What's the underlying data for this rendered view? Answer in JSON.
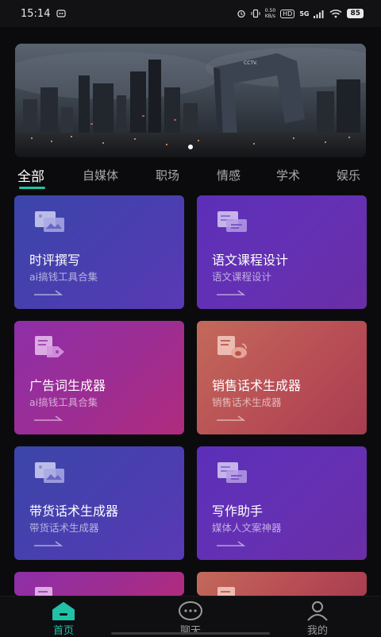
{
  "status_bar": {
    "time": "15:14",
    "network_speed_value": "0.50",
    "network_speed_unit": "KB/s",
    "hd_label": "HD",
    "network_type": "5G",
    "battery": "85"
  },
  "banner": {
    "sign_text": "CCTV."
  },
  "tabs": [
    {
      "label": "全部",
      "active": true
    },
    {
      "label": "自媒体",
      "active": false
    },
    {
      "label": "职场",
      "active": false
    },
    {
      "label": "情感",
      "active": false
    },
    {
      "label": "学术",
      "active": false
    },
    {
      "label": "娱乐",
      "active": false
    }
  ],
  "cards": [
    {
      "title": "时评撰写",
      "subtitle": "ai搞钱工具合集",
      "icon": "image-document-icon"
    },
    {
      "title": "语文课程设计",
      "subtitle": "语文课程设计",
      "icon": "notes-document-icon"
    },
    {
      "title": "广告词生成器",
      "subtitle": "ai搞钱工具合集",
      "icon": "document-tag-icon"
    },
    {
      "title": "销售话术生成器",
      "subtitle": "销售话术生成器",
      "icon": "weibo-document-icon"
    },
    {
      "title": "带货话术生成器",
      "subtitle": "带货话术生成器",
      "icon": "image-document-icon"
    },
    {
      "title": "写作助手",
      "subtitle": "媒体人文案神器",
      "icon": "notes-document-icon"
    }
  ],
  "bottom_nav": [
    {
      "label": "首页",
      "icon": "home-icon",
      "active": true
    },
    {
      "label": "聊天",
      "icon": "chat-bubble-icon",
      "active": false
    },
    {
      "label": "我的",
      "icon": "user-icon",
      "active": false
    }
  ],
  "colors": {
    "accent": "#20c2a8",
    "background": "#0b0b0d"
  }
}
